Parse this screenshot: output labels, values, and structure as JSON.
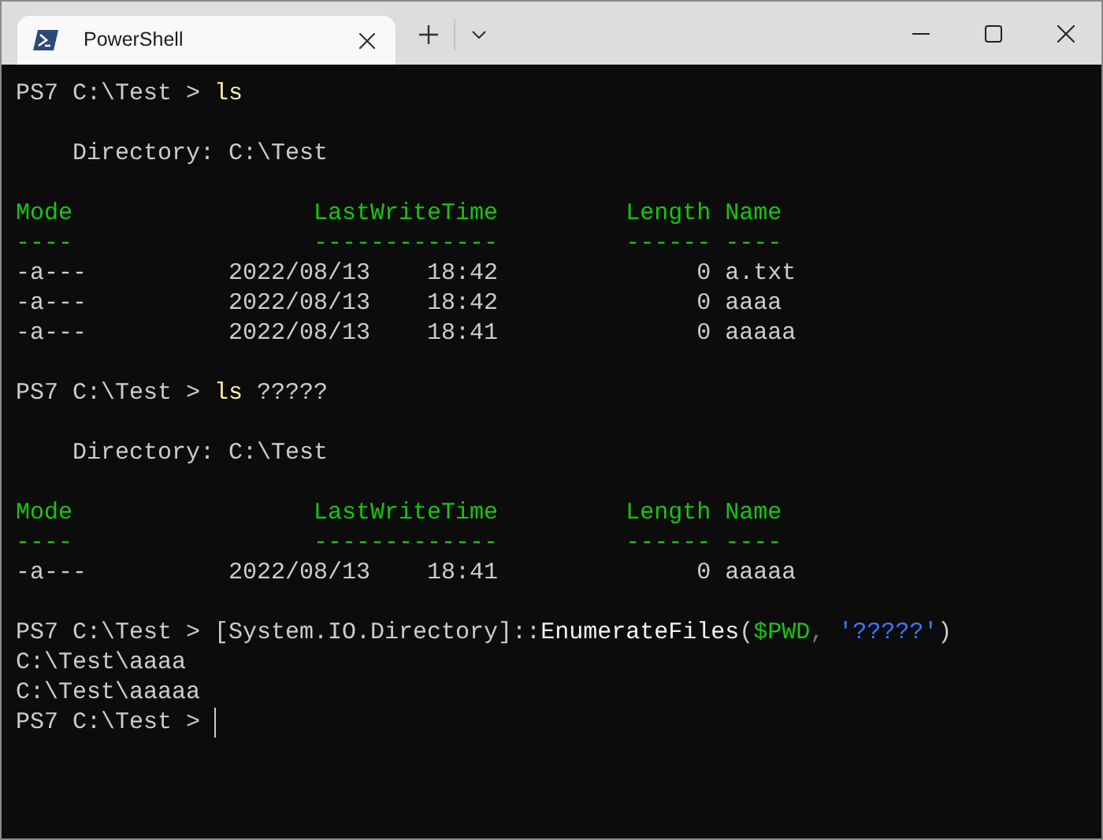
{
  "window": {
    "tabs": [
      {
        "title": "PowerShell",
        "selected": true
      }
    ]
  },
  "terminal": {
    "lines": [
      {
        "segments": [
          {
            "kind": "text",
            "text": "PS7 C:\\Test > "
          },
          {
            "kind": "command",
            "text": "ls"
          }
        ]
      },
      {
        "gap_before": true,
        "segments": [
          {
            "kind": "text",
            "text": "    Directory: C:\\Test"
          }
        ]
      },
      {
        "gap_before": true,
        "segments": [
          {
            "kind": "header",
            "text": "Mode                 LastWriteTime         Length Name"
          }
        ]
      },
      {
        "segments": [
          {
            "kind": "header",
            "text": "----                 -------------         ------ ----"
          }
        ]
      },
      {
        "segments": [
          {
            "kind": "text",
            "text": "-a---          2022/08/13    18:42              0 a.txt"
          }
        ]
      },
      {
        "segments": [
          {
            "kind": "text",
            "text": "-a---          2022/08/13    18:42              0 aaaa"
          }
        ]
      },
      {
        "segments": [
          {
            "kind": "text",
            "text": "-a---          2022/08/13    18:41              0 aaaaa"
          }
        ]
      },
      {
        "gap_before": true,
        "segments": [
          {
            "kind": "text",
            "text": "PS7 C:\\Test > "
          },
          {
            "kind": "command",
            "text": "ls"
          },
          {
            "kind": "text",
            "text": " ?????"
          }
        ]
      },
      {
        "gap_before": true,
        "segments": [
          {
            "kind": "text",
            "text": "    Directory: C:\\Test"
          }
        ]
      },
      {
        "gap_before": true,
        "segments": [
          {
            "kind": "header",
            "text": "Mode                 LastWriteTime         Length Name"
          }
        ]
      },
      {
        "segments": [
          {
            "kind": "header",
            "text": "----                 -------------         ------ ----"
          }
        ]
      },
      {
        "segments": [
          {
            "kind": "text",
            "text": "-a---          2022/08/13    18:41              0 aaaaa"
          }
        ]
      },
      {
        "gap_before": true,
        "segments": [
          {
            "kind": "text",
            "text": "PS7 C:\\Test > [System.IO.Directory]::"
          },
          {
            "kind": "method",
            "text": "EnumerateFiles"
          },
          {
            "kind": "text",
            "text": "("
          },
          {
            "kind": "variable",
            "text": "$PWD"
          },
          {
            "kind": "dim",
            "text": ", "
          },
          {
            "kind": "string",
            "text": "'?????'"
          },
          {
            "kind": "text",
            "text": ")"
          }
        ]
      },
      {
        "segments": [
          {
            "kind": "text",
            "text": "C:\\Test\\aaaa"
          }
        ]
      },
      {
        "segments": [
          {
            "kind": "text",
            "text": "C:\\Test\\aaaaa"
          }
        ]
      },
      {
        "cursor": true,
        "segments": [
          {
            "kind": "text",
            "text": "PS7 C:\\Test > "
          }
        ]
      }
    ]
  }
}
